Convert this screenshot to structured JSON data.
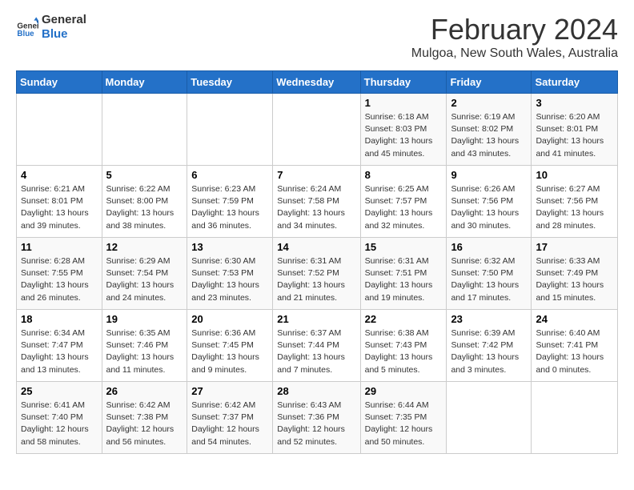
{
  "logo": {
    "line1": "General",
    "line2": "Blue"
  },
  "title": "February 2024",
  "subtitle": "Mulgoa, New South Wales, Australia",
  "headers": [
    "Sunday",
    "Monday",
    "Tuesday",
    "Wednesday",
    "Thursday",
    "Friday",
    "Saturday"
  ],
  "weeks": [
    [
      {
        "day": "",
        "detail": ""
      },
      {
        "day": "",
        "detail": ""
      },
      {
        "day": "",
        "detail": ""
      },
      {
        "day": "",
        "detail": ""
      },
      {
        "day": "1",
        "detail": "Sunrise: 6:18 AM\nSunset: 8:03 PM\nDaylight: 13 hours\nand 45 minutes."
      },
      {
        "day": "2",
        "detail": "Sunrise: 6:19 AM\nSunset: 8:02 PM\nDaylight: 13 hours\nand 43 minutes."
      },
      {
        "day": "3",
        "detail": "Sunrise: 6:20 AM\nSunset: 8:01 PM\nDaylight: 13 hours\nand 41 minutes."
      }
    ],
    [
      {
        "day": "4",
        "detail": "Sunrise: 6:21 AM\nSunset: 8:01 PM\nDaylight: 13 hours\nand 39 minutes."
      },
      {
        "day": "5",
        "detail": "Sunrise: 6:22 AM\nSunset: 8:00 PM\nDaylight: 13 hours\nand 38 minutes."
      },
      {
        "day": "6",
        "detail": "Sunrise: 6:23 AM\nSunset: 7:59 PM\nDaylight: 13 hours\nand 36 minutes."
      },
      {
        "day": "7",
        "detail": "Sunrise: 6:24 AM\nSunset: 7:58 PM\nDaylight: 13 hours\nand 34 minutes."
      },
      {
        "day": "8",
        "detail": "Sunrise: 6:25 AM\nSunset: 7:57 PM\nDaylight: 13 hours\nand 32 minutes."
      },
      {
        "day": "9",
        "detail": "Sunrise: 6:26 AM\nSunset: 7:56 PM\nDaylight: 13 hours\nand 30 minutes."
      },
      {
        "day": "10",
        "detail": "Sunrise: 6:27 AM\nSunset: 7:56 PM\nDaylight: 13 hours\nand 28 minutes."
      }
    ],
    [
      {
        "day": "11",
        "detail": "Sunrise: 6:28 AM\nSunset: 7:55 PM\nDaylight: 13 hours\nand 26 minutes."
      },
      {
        "day": "12",
        "detail": "Sunrise: 6:29 AM\nSunset: 7:54 PM\nDaylight: 13 hours\nand 24 minutes."
      },
      {
        "day": "13",
        "detail": "Sunrise: 6:30 AM\nSunset: 7:53 PM\nDaylight: 13 hours\nand 23 minutes."
      },
      {
        "day": "14",
        "detail": "Sunrise: 6:31 AM\nSunset: 7:52 PM\nDaylight: 13 hours\nand 21 minutes."
      },
      {
        "day": "15",
        "detail": "Sunrise: 6:31 AM\nSunset: 7:51 PM\nDaylight: 13 hours\nand 19 minutes."
      },
      {
        "day": "16",
        "detail": "Sunrise: 6:32 AM\nSunset: 7:50 PM\nDaylight: 13 hours\nand 17 minutes."
      },
      {
        "day": "17",
        "detail": "Sunrise: 6:33 AM\nSunset: 7:49 PM\nDaylight: 13 hours\nand 15 minutes."
      }
    ],
    [
      {
        "day": "18",
        "detail": "Sunrise: 6:34 AM\nSunset: 7:47 PM\nDaylight: 13 hours\nand 13 minutes."
      },
      {
        "day": "19",
        "detail": "Sunrise: 6:35 AM\nSunset: 7:46 PM\nDaylight: 13 hours\nand 11 minutes."
      },
      {
        "day": "20",
        "detail": "Sunrise: 6:36 AM\nSunset: 7:45 PM\nDaylight: 13 hours\nand 9 minutes."
      },
      {
        "day": "21",
        "detail": "Sunrise: 6:37 AM\nSunset: 7:44 PM\nDaylight: 13 hours\nand 7 minutes."
      },
      {
        "day": "22",
        "detail": "Sunrise: 6:38 AM\nSunset: 7:43 PM\nDaylight: 13 hours\nand 5 minutes."
      },
      {
        "day": "23",
        "detail": "Sunrise: 6:39 AM\nSunset: 7:42 PM\nDaylight: 13 hours\nand 3 minutes."
      },
      {
        "day": "24",
        "detail": "Sunrise: 6:40 AM\nSunset: 7:41 PM\nDaylight: 13 hours\nand 0 minutes."
      }
    ],
    [
      {
        "day": "25",
        "detail": "Sunrise: 6:41 AM\nSunset: 7:40 PM\nDaylight: 12 hours\nand 58 minutes."
      },
      {
        "day": "26",
        "detail": "Sunrise: 6:42 AM\nSunset: 7:38 PM\nDaylight: 12 hours\nand 56 minutes."
      },
      {
        "day": "27",
        "detail": "Sunrise: 6:42 AM\nSunset: 7:37 PM\nDaylight: 12 hours\nand 54 minutes."
      },
      {
        "day": "28",
        "detail": "Sunrise: 6:43 AM\nSunset: 7:36 PM\nDaylight: 12 hours\nand 52 minutes."
      },
      {
        "day": "29",
        "detail": "Sunrise: 6:44 AM\nSunset: 7:35 PM\nDaylight: 12 hours\nand 50 minutes."
      },
      {
        "day": "",
        "detail": ""
      },
      {
        "day": "",
        "detail": ""
      }
    ]
  ]
}
